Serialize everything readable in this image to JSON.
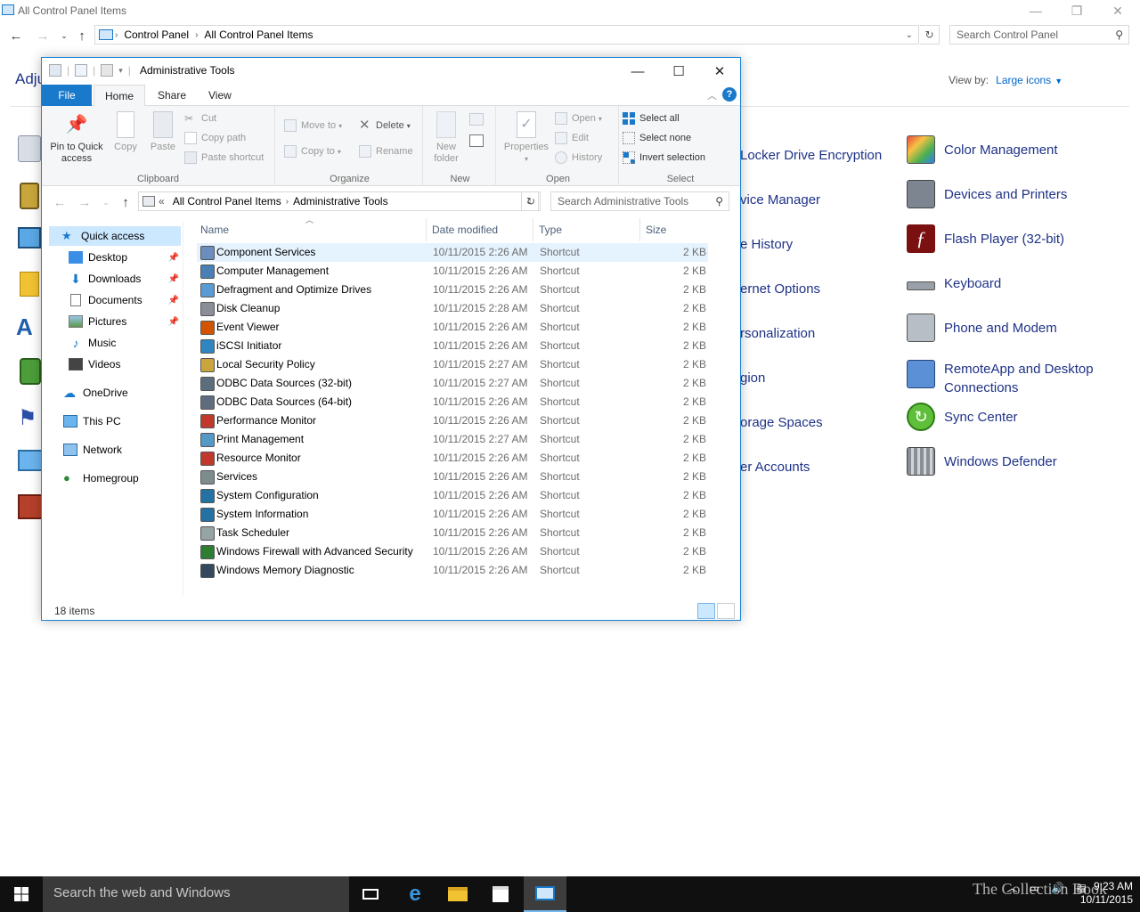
{
  "control_panel": {
    "title": "All Control Panel Items",
    "breadcrumb": [
      "Control Panel",
      "All Control Panel Items"
    ],
    "search_placeholder": "Search Control Panel",
    "heading_partial": "Adju",
    "view_by_label": "View by:",
    "view_by_value": "Large icons",
    "middle_items": [
      "Locker Drive Encryption",
      "vice Manager",
      "e History",
      "ernet Options",
      "rsonalization",
      "gion",
      "orage Spaces",
      "er Accounts"
    ],
    "right_items": [
      {
        "label": "Color Management",
        "icon": "color-management-icon"
      },
      {
        "label": "Devices and Printers",
        "icon": "devices-printers-icon"
      },
      {
        "label": "Flash Player (32-bit)",
        "icon": "flash-player-icon"
      },
      {
        "label": "Keyboard",
        "icon": "keyboard-icon"
      },
      {
        "label": "Phone and Modem",
        "icon": "phone-modem-icon"
      },
      {
        "label": "RemoteApp and Desktop Connections",
        "icon": "remoteapp-icon"
      },
      {
        "label": "Sync Center",
        "icon": "sync-center-icon"
      },
      {
        "label": "Windows Defender",
        "icon": "windows-defender-icon"
      }
    ]
  },
  "explorer": {
    "title": "Administrative Tools",
    "tabs": {
      "file": "File",
      "home": "Home",
      "share": "Share",
      "view": "View"
    },
    "ribbon": {
      "clipboard": {
        "pin": "Pin to Quick access",
        "copy": "Copy",
        "paste": "Paste",
        "cut": "Cut",
        "copy_path": "Copy path",
        "paste_shortcut": "Paste shortcut",
        "label": "Clipboard"
      },
      "organize": {
        "move_to": "Move to",
        "copy_to": "Copy to",
        "delete": "Delete",
        "rename": "Rename",
        "label": "Organize"
      },
      "new": {
        "new_folder": "New folder",
        "label": "New"
      },
      "open": {
        "properties": "Properties",
        "open": "Open",
        "edit": "Edit",
        "history": "History",
        "label": "Open"
      },
      "select": {
        "select_all": "Select all",
        "select_none": "Select none",
        "invert": "Invert selection",
        "label": "Select"
      }
    },
    "address": {
      "breadcrumb": [
        "All Control Panel Items",
        "Administrative Tools"
      ],
      "overflow": "«",
      "search_placeholder": "Search Administrative Tools"
    },
    "nav": {
      "quick_access": "Quick access",
      "pinned": [
        "Desktop",
        "Downloads",
        "Documents",
        "Pictures"
      ],
      "unpinned": [
        "Music",
        "Videos"
      ],
      "onedrive": "OneDrive",
      "this_pc": "This PC",
      "network": "Network",
      "homegroup": "Homegroup"
    },
    "columns": {
      "name": "Name",
      "date": "Date modified",
      "type": "Type",
      "size": "Size"
    },
    "files": [
      {
        "name": "Component Services",
        "date": "10/11/2015 2:26 AM",
        "type": "Shortcut",
        "size": "2 KB"
      },
      {
        "name": "Computer Management",
        "date": "10/11/2015 2:26 AM",
        "type": "Shortcut",
        "size": "2 KB"
      },
      {
        "name": "Defragment and Optimize Drives",
        "date": "10/11/2015 2:26 AM",
        "type": "Shortcut",
        "size": "2 KB"
      },
      {
        "name": "Disk Cleanup",
        "date": "10/11/2015 2:28 AM",
        "type": "Shortcut",
        "size": "2 KB"
      },
      {
        "name": "Event Viewer",
        "date": "10/11/2015 2:26 AM",
        "type": "Shortcut",
        "size": "2 KB"
      },
      {
        "name": "iSCSI Initiator",
        "date": "10/11/2015 2:26 AM",
        "type": "Shortcut",
        "size": "2 KB"
      },
      {
        "name": "Local Security Policy",
        "date": "10/11/2015 2:27 AM",
        "type": "Shortcut",
        "size": "2 KB"
      },
      {
        "name": "ODBC Data Sources (32-bit)",
        "date": "10/11/2015 2:27 AM",
        "type": "Shortcut",
        "size": "2 KB"
      },
      {
        "name": "ODBC Data Sources (64-bit)",
        "date": "10/11/2015 2:26 AM",
        "type": "Shortcut",
        "size": "2 KB"
      },
      {
        "name": "Performance Monitor",
        "date": "10/11/2015 2:26 AM",
        "type": "Shortcut",
        "size": "2 KB"
      },
      {
        "name": "Print Management",
        "date": "10/11/2015 2:27 AM",
        "type": "Shortcut",
        "size": "2 KB"
      },
      {
        "name": "Resource Monitor",
        "date": "10/11/2015 2:26 AM",
        "type": "Shortcut",
        "size": "2 KB"
      },
      {
        "name": "Services",
        "date": "10/11/2015 2:26 AM",
        "type": "Shortcut",
        "size": "2 KB"
      },
      {
        "name": "System Configuration",
        "date": "10/11/2015 2:26 AM",
        "type": "Shortcut",
        "size": "2 KB"
      },
      {
        "name": "System Information",
        "date": "10/11/2015 2:26 AM",
        "type": "Shortcut",
        "size": "2 KB"
      },
      {
        "name": "Task Scheduler",
        "date": "10/11/2015 2:26 AM",
        "type": "Shortcut",
        "size": "2 KB"
      },
      {
        "name": "Windows Firewall with Advanced Security",
        "date": "10/11/2015 2:26 AM",
        "type": "Shortcut",
        "size": "2 KB"
      },
      {
        "name": "Windows Memory Diagnostic",
        "date": "10/11/2015 2:26 AM",
        "type": "Shortcut",
        "size": "2 KB"
      }
    ],
    "status": "18 items"
  },
  "taskbar": {
    "search_placeholder": "Search the web and Windows",
    "time": "9:23 AM",
    "date": "10/11/2015",
    "watermark": "The Collection Book"
  },
  "colors": {
    "accent": "#1979ca",
    "link": "#1e3287",
    "selection": "#cce8ff",
    "taskbar": "#101010"
  }
}
